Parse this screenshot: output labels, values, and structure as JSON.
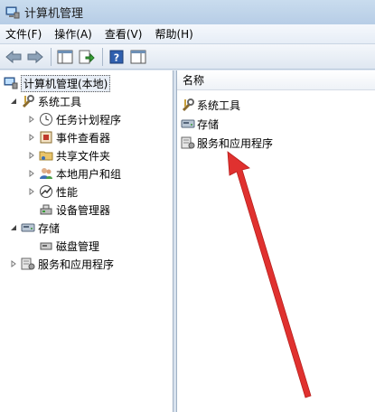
{
  "window": {
    "title": "计算机管理"
  },
  "menu": [
    {
      "label": "文件(F)"
    },
    {
      "label": "操作(A)"
    },
    {
      "label": "查看(V)"
    },
    {
      "label": "帮助(H)"
    }
  ],
  "toolbar": {
    "icons": [
      "back-arrow-icon",
      "forward-arrow-icon",
      "show-hide-tree-icon",
      "export-list-icon",
      "help-icon",
      "properties-pane-icon"
    ]
  },
  "tree": {
    "root": {
      "label": "计算机管理(本地)",
      "icon": "computer-management-icon"
    },
    "system_tools": {
      "label": "系统工具",
      "icon": "tools-icon"
    },
    "task_scheduler": {
      "label": "任务计划程序",
      "icon": "clock-icon"
    },
    "event_viewer": {
      "label": "事件查看器",
      "icon": "event-log-icon"
    },
    "shared_folders": {
      "label": "共享文件夹",
      "icon": "shared-folder-icon"
    },
    "local_users": {
      "label": "本地用户和组",
      "icon": "users-icon"
    },
    "performance": {
      "label": "性能",
      "icon": "performance-icon"
    },
    "device_manager": {
      "label": "设备管理器",
      "icon": "device-manager-icon"
    },
    "storage": {
      "label": "存储",
      "icon": "storage-icon"
    },
    "disk_management": {
      "label": "磁盘管理",
      "icon": "disk-icon"
    },
    "services": {
      "label": "服务和应用程序",
      "icon": "services-icon"
    }
  },
  "list": {
    "column_header": "名称",
    "items": [
      {
        "label": "系统工具",
        "icon": "tools-icon"
      },
      {
        "label": "存储",
        "icon": "storage-icon"
      },
      {
        "label": "服务和应用程序",
        "icon": "services-icon"
      }
    ]
  },
  "colors": {
    "annotation_arrow": "#e0312f",
    "selection_bg": "#e8eef6"
  }
}
